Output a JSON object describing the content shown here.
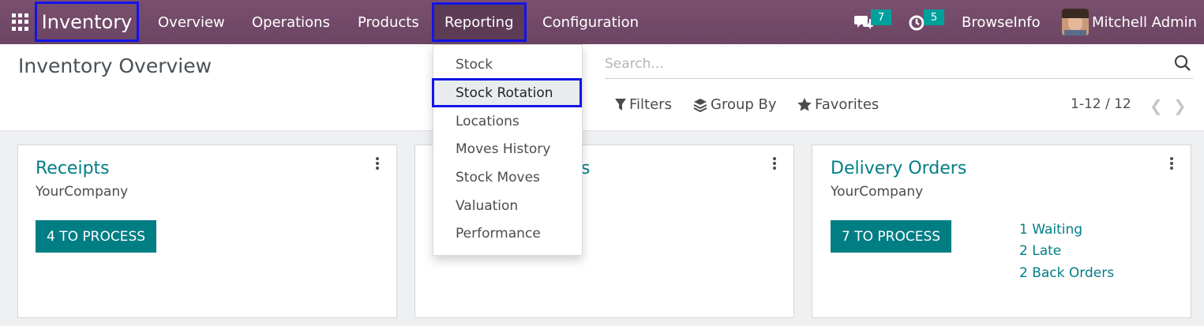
{
  "navbar": {
    "app_name": "Inventory",
    "menu": [
      "Overview",
      "Operations",
      "Products",
      "Reporting",
      "Configuration"
    ],
    "messages_badge": "7",
    "activities_badge": "5",
    "company": "BrowseInfo",
    "user": "Mitchell Admin"
  },
  "reporting_menu": {
    "items": [
      "Stock",
      "Stock Rotation",
      "Locations",
      "Moves History",
      "Stock Moves",
      "Valuation",
      "Performance"
    ],
    "highlighted": "Stock Rotation"
  },
  "control_panel": {
    "title": "Inventory Overview",
    "search_placeholder": "Search...",
    "filters_label": "Filters",
    "groupby_label": "Group By",
    "favorites_label": "Favorites",
    "pager": "1-12 / 12"
  },
  "cards": [
    {
      "title": "Receipts",
      "company": "YourCompany",
      "button": "4 TO PROCESS",
      "stats": []
    },
    {
      "title": "s",
      "company": "",
      "button": "",
      "stats": []
    },
    {
      "title": "Delivery Orders",
      "company": "YourCompany",
      "button": "7 TO PROCESS",
      "stats": [
        "1 Waiting",
        "2 Late",
        "2 Back Orders"
      ]
    }
  ],
  "colors": {
    "navbar": "#714b67",
    "highlight_border": "#1414e6",
    "accent": "#017e84",
    "badge": "#00a09d"
  }
}
